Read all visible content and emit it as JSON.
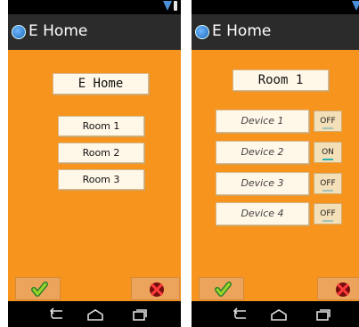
{
  "left": {
    "app_title": "E Home",
    "header_button": "E Home",
    "rooms": [
      "Room 1",
      "Room 2",
      "Room 3"
    ]
  },
  "right": {
    "app_title": "E Home",
    "header_button": "Room 1",
    "devices": [
      {
        "label": "Device 1",
        "state": "OFF"
      },
      {
        "label": "Device 2",
        "state": "ON"
      },
      {
        "label": "Device 3",
        "state": "OFF"
      },
      {
        "label": "Device 4",
        "state": "OFF"
      }
    ]
  },
  "colors": {
    "background": "#f7941d",
    "actionbar": "#2b2b2b",
    "button": "#fff7e8",
    "toggle_on_indicator": "#2cb3b0",
    "toggle_off_indicator": "#a3c3b9"
  },
  "icons": {
    "status": [
      "wifi-icon",
      "battery-icon"
    ],
    "bottom": [
      "check-icon",
      "close-x-icon"
    ],
    "nav": [
      "back-icon",
      "home-icon",
      "recents-icon"
    ]
  }
}
